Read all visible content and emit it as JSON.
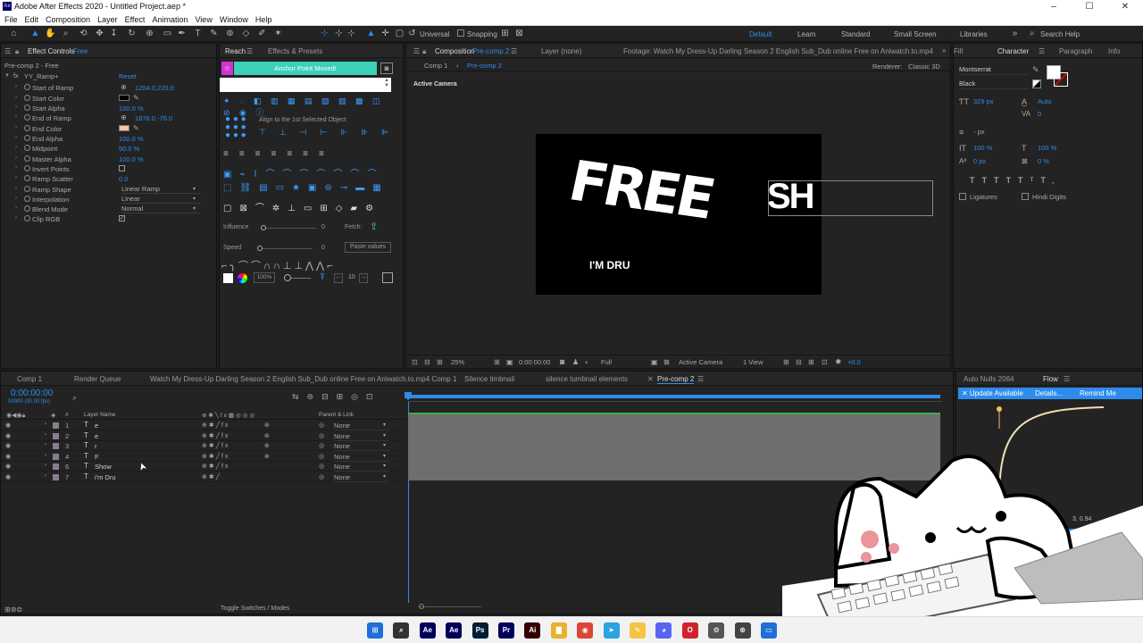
{
  "window": {
    "title": "Adobe After Effects 2020 - Untitled Project.aep *",
    "min": "–",
    "max": "☐",
    "close": "✕"
  },
  "menu": [
    "File",
    "Edit",
    "Composition",
    "Layer",
    "Effect",
    "Animation",
    "View",
    "Window",
    "Help"
  ],
  "toolbar": {
    "universal": "Universal",
    "snapping": "Snapping",
    "workspaces": [
      "Default",
      "Learn",
      "Standard",
      "Small Screen",
      "Libraries"
    ],
    "search_placeholder": "Search Help"
  },
  "effect_controls": {
    "tab": "Effect Controls",
    "tab_layer": "Free",
    "breadcrumb": "Pre-comp 2 - Free",
    "effect": "YY_Ramp+",
    "reset": "Reset",
    "rows": [
      {
        "name": "Start of Ramp",
        "value": "1204.0,220.0",
        "kind": "point"
      },
      {
        "name": "Start Color",
        "kind": "color",
        "color": "#000000"
      },
      {
        "name": "Start Alpha",
        "value": "100.0 %"
      },
      {
        "name": "End of Ramp",
        "value": "1876.0,-76.0",
        "kind": "point"
      },
      {
        "name": "End Color",
        "kind": "color",
        "color": "#f2c7a8"
      },
      {
        "name": "End Alpha",
        "value": "100.0 %"
      },
      {
        "name": "Midpoint",
        "value": "50.0 %"
      },
      {
        "name": "Master Alpha",
        "value": "100.0 %"
      },
      {
        "name": "Invert Points",
        "kind": "check",
        "checked": false
      },
      {
        "name": "Ramp Scatter",
        "value": "0.0"
      },
      {
        "name": "Ramp Shape",
        "kind": "select",
        "value": "Linear Ramp"
      },
      {
        "name": "Interpolation",
        "kind": "select",
        "value": "Linear"
      },
      {
        "name": "Blend Mode",
        "kind": "select",
        "value": "Normal"
      },
      {
        "name": "Clip RGB",
        "kind": "check",
        "checked": true
      }
    ]
  },
  "reach": {
    "tab": "Reach",
    "tab2": "Effects & Presets",
    "banner": "Anchor Point Moved!",
    "align_label": "Align to the 1st Selected Object",
    "influence": "Influence",
    "influence_val": "0",
    "fetch": "Fetch:",
    "speed": "Speed",
    "speed_val": "0",
    "paste": "Paste values",
    "zoom_pct": "100%",
    "num": "10"
  },
  "composition": {
    "tab": "Composition",
    "tab_name": "Pre-comp 2",
    "layer_tab": "Layer (none)",
    "footage_tab": "Footage: Watch My Dress-Up Darling Season 2 English Sub_Dub online Free on Aniwatch.to.mp4",
    "crumbs": [
      "Comp 1",
      "Pre-comp 2"
    ],
    "renderer_label": "Renderer:",
    "renderer": "Classic 3D",
    "active_camera": "Active Camera",
    "text_free": "FREE",
    "text_sh": "SH",
    "text_dru": "I'M DRU",
    "footer": {
      "zoom": "25%",
      "time": "0:00:00:00",
      "res": "Full",
      "camera": "Active Camera",
      "views": "1 View",
      "exposure": "+0.0"
    }
  },
  "character": {
    "tabs": [
      "Fill",
      "Character",
      "Paragraph",
      "Info"
    ],
    "font": "Montserrat",
    "style": "Black",
    "size": "329 px",
    "leading": "Auto",
    "tracking": "0",
    "units": "- px",
    "vscale": "100 %",
    "hscale": "100 %",
    "baseline": "0 px",
    "tsume": "0 %",
    "ligatures": "Ligatures",
    "hindi": "Hindi Digits"
  },
  "timeline": {
    "tabs": [
      "Comp 1",
      "Render Queue",
      "Watch My Dress-Up Darling Season 2 English Sub_Dub online Free on Aniwatch.to.mp4 Comp 1",
      "Silence timbnail",
      "silence tumbnail elements",
      "Pre-comp 2"
    ],
    "timecode": "0:00:00:00",
    "fps": "00000 (30.00 fps)",
    "col_hash": "#",
    "col_name": "Layer Name",
    "col_parent": "Parent & Link",
    "toggle": "Toggle Switches / Modes",
    "layers": [
      {
        "num": "1",
        "name": "e",
        "parent": "None"
      },
      {
        "num": "2",
        "name": "e",
        "parent": "None"
      },
      {
        "num": "3",
        "name": "r",
        "parent": "None"
      },
      {
        "num": "4",
        "name": "F",
        "parent": "None"
      },
      {
        "num": "6",
        "name": "Show",
        "parent": "None"
      },
      {
        "num": "7",
        "name": "i'm Dru",
        "parent": "None"
      }
    ]
  },
  "flow": {
    "tab1": "Auto Nulls 2064",
    "tab2": "Flow",
    "update": "✕ Update Available",
    "details": "Details...",
    "remind": "Remind Me",
    "value": "3, 0.94"
  },
  "taskbar": [
    {
      "name": "windows-icon",
      "label": "⊞",
      "color": "#1e6fd9"
    },
    {
      "name": "search-icon",
      "label": "⌕",
      "color": "#333333"
    },
    {
      "name": "ae-icon",
      "label": "Ae",
      "color": "#00005b"
    },
    {
      "name": "ae-icon-2",
      "label": "Ae",
      "color": "#00005b"
    },
    {
      "name": "ps-icon",
      "label": "Ps",
      "color": "#001e36"
    },
    {
      "name": "pr-icon",
      "label": "Pr",
      "color": "#00005b"
    },
    {
      "name": "ai-icon",
      "label": "Ai",
      "color": "#330000"
    },
    {
      "name": "folder-icon",
      "label": "▇",
      "color": "#e8b22a"
    },
    {
      "name": "chrome-icon",
      "label": "◉",
      "color": "#db4437"
    },
    {
      "name": "telegram-icon",
      "label": "➤",
      "color": "#2aa3de"
    },
    {
      "name": "notes-icon",
      "label": "✎",
      "color": "#f5c542"
    },
    {
      "name": "discord-icon",
      "label": "◕",
      "color": "#5865f2"
    },
    {
      "name": "opera-icon",
      "label": "O",
      "color": "#d0242c"
    },
    {
      "name": "settings-icon",
      "label": "⚙",
      "color": "#555555"
    },
    {
      "name": "app-icon",
      "label": "⊛",
      "color": "#444444"
    },
    {
      "name": "monitor-icon",
      "label": "▭",
      "color": "#1e6fd9"
    }
  ]
}
